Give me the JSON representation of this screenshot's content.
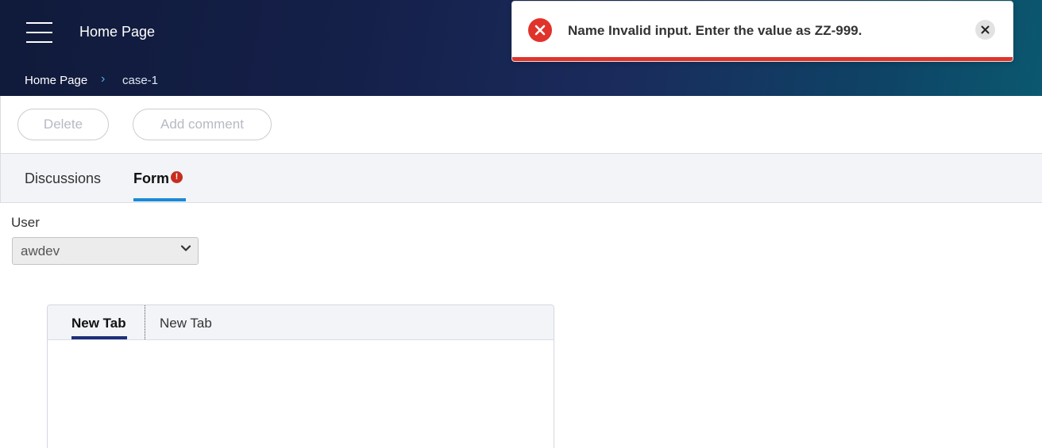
{
  "header": {
    "title": "Home Page",
    "menu_icon": "hamburger-menu-icon",
    "gradient_colors": [
      "#101a3a",
      "#1a2b5c",
      "#0b5870"
    ]
  },
  "breadcrumb": {
    "items": [
      "Home Page",
      "case-1"
    ],
    "separator_icon": "chevron-right-icon",
    "separator_color": "#59a9e8"
  },
  "toolbar": {
    "delete_label": "Delete",
    "comment_label": "Add comment"
  },
  "tabs": {
    "items": [
      {
        "label": "Discussions",
        "active": false
      },
      {
        "label": "Form",
        "active": true,
        "error": true
      }
    ],
    "active_color": "#1a8ad6",
    "error_icon": "exclamation-circle-icon",
    "error_color": "#c62d1f"
  },
  "form": {
    "user_label": "User",
    "user_value": "awdev",
    "select_icon": "chevron-down-icon"
  },
  "inner_tabs": {
    "items": [
      {
        "label": "New Tab",
        "active": true
      },
      {
        "label": "New Tab",
        "active": false
      }
    ],
    "active_color": "#1e2f7a"
  },
  "toast": {
    "message": "Name Invalid input. Enter the value as ZZ-999.",
    "status_icon": "error-circle-icon",
    "close_icon": "close-icon",
    "accent_color": "#e0332b"
  }
}
